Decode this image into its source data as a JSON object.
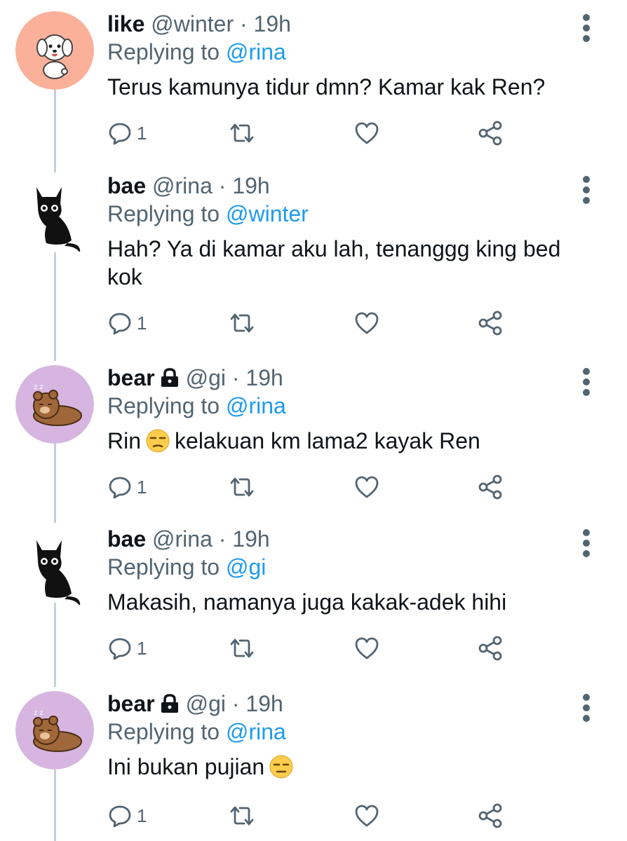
{
  "tweets": [
    {
      "name": "like",
      "handle": "@winter",
      "sep": "·",
      "time": "19h",
      "replying_label": "Replying to",
      "replying_to": "@rina",
      "text": "Terus kamunya tidur dmn? Kamar kak Ren?",
      "reply_count": "1",
      "avatar": "dog-avatar",
      "locked": false
    },
    {
      "name": "bae",
      "handle": "@rina",
      "sep": "·",
      "time": "19h",
      "replying_label": "Replying to",
      "replying_to": "@winter",
      "text": "Hah? Ya di kamar aku lah, tenanggg king bed kok",
      "reply_count": "1",
      "avatar": "cat-avatar",
      "locked": false
    },
    {
      "name": "bear",
      "handle": "@gi",
      "sep": "·",
      "time": "19h",
      "replying_label": "Replying to",
      "replying_to": "@rina",
      "text_before": "Rin",
      "text_after": "kelakuan km lama2 kayak Ren",
      "emoji": "unamused-face-emoji",
      "reply_count": "1",
      "avatar": "bear-avatar",
      "locked": true
    },
    {
      "name": "bae",
      "handle": "@rina",
      "sep": "·",
      "time": "19h",
      "replying_label": "Replying to",
      "replying_to": "@gi",
      "text": "Makasih, namanya juga kakak-adek hihi",
      "reply_count": "1",
      "avatar": "cat-avatar",
      "locked": false
    },
    {
      "name": "bear",
      "handle": "@gi",
      "sep": "·",
      "time": "19h",
      "replying_label": "Replying to",
      "replying_to": "@rina",
      "text_before": "Ini bukan pujian",
      "emoji": "expressionless-face-emoji",
      "reply_count": "1",
      "avatar": "bear-avatar",
      "locked": true
    }
  ],
  "icons": {
    "reply": "reply-icon",
    "retweet": "retweet-icon",
    "like": "heart-icon",
    "share": "share-icon",
    "more": "more-icon",
    "lock": "lock-icon"
  },
  "colors": {
    "link": "#1d9bf0",
    "secondary_text": "#536471",
    "thread_line": "#c4cfd6",
    "dog_avatar_bg": "#fbb09a",
    "bear_avatar_bg": "#d6b6e0"
  }
}
